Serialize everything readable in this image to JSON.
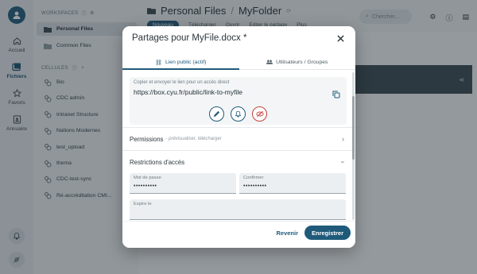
{
  "rail": {
    "items": [
      {
        "label": "Accueil",
        "icon": "home-icon"
      },
      {
        "label": "Fichiers",
        "icon": "files-icon"
      },
      {
        "label": "Favoris",
        "icon": "star-icon"
      },
      {
        "label": "Annuaire",
        "icon": "directory-icon"
      }
    ]
  },
  "sidebar": {
    "workspaces_header": "WORKSPACES",
    "workspaces": [
      {
        "label": "Personal Files"
      },
      {
        "label": "Common Files"
      }
    ],
    "cells_header": "CELLULES",
    "cells": [
      {
        "label": "Bio"
      },
      {
        "label": "CDC admin"
      },
      {
        "label": "Intranet Structure"
      },
      {
        "label": "Nations Modernes"
      },
      {
        "label": "test_upload"
      },
      {
        "label": "thema"
      },
      {
        "label": "CDC-test-sync"
      },
      {
        "label": "Ré-accréditation CMI..."
      }
    ]
  },
  "topbar": {
    "crumb_root": "Personal Files",
    "crumb_sep": "/",
    "crumb_current": "MyFolder",
    "toolbar": [
      "Nouveau",
      "Télécharger",
      "Ouvrir",
      "Editer le partage",
      "Plus"
    ],
    "search_placeholder": "Chercher..."
  },
  "dialog": {
    "title": "Partages pour MyFile.docx *",
    "tab_public": "Lien public (actif)",
    "tab_users": "Utilisateurs / Groupes",
    "link_caption": "Copier et envoyer le lien pour un accès direct",
    "link_url": "https://box.cyu.fr/public/link-to-myfile",
    "permissions_label": "Permissions",
    "permissions_sub": "- prévisualiser, télécharger",
    "restrictions_label": "Restrictions d'accès",
    "password_label": "Mot de passe",
    "password_value": "••••••••••",
    "confirm_label": "Confirmer",
    "confirm_value": "••••••••••",
    "expires_label": "Expire le",
    "revert_label": "Revenir",
    "save_label": "Enregistrer"
  },
  "colors": {
    "accent": "#1f5a7a",
    "danger": "#c2403b",
    "overlay": "#1e282e"
  }
}
